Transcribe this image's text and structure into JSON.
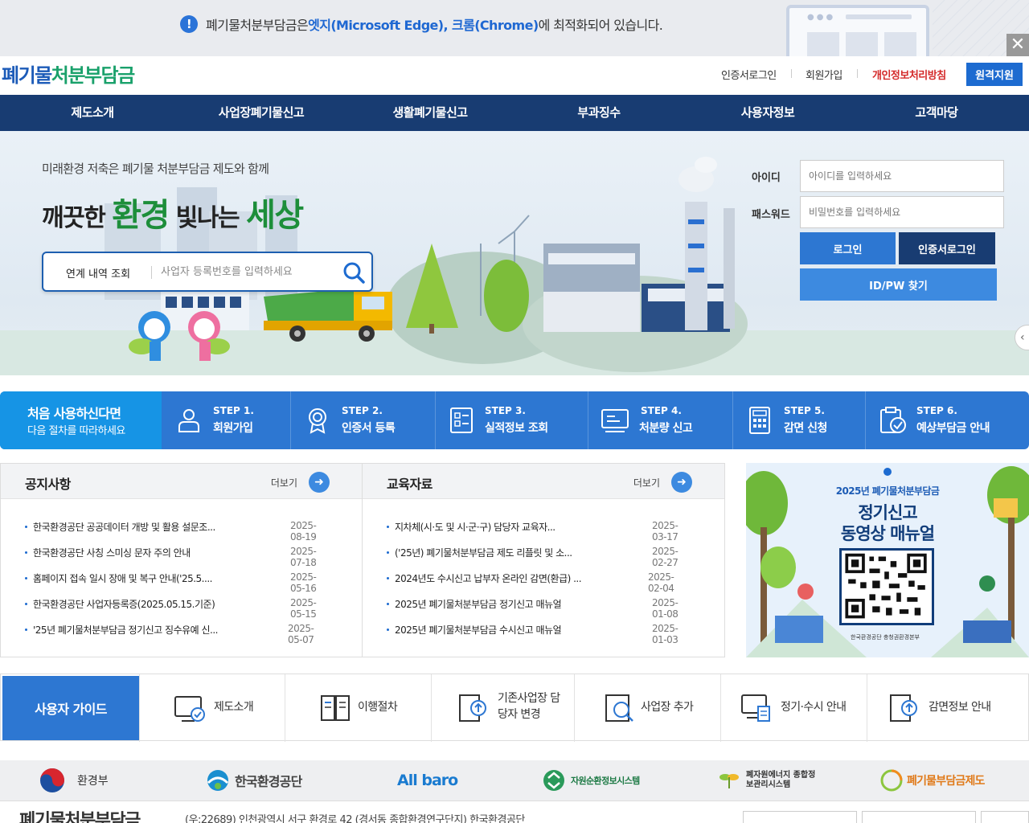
{
  "notice": {
    "text_before": "폐기물처분부담금은 ",
    "browsers": "엣지(Microsoft Edge), 크롬(Chrome)",
    "text_after": "에 최적화되어 있습니다.",
    "close_glyph": "✕"
  },
  "header": {
    "logo_part1": "폐기물",
    "logo_part2": "처분부담금",
    "links": [
      "인증서로그인",
      "회원가입",
      "개인정보처리방침"
    ],
    "remote_support": "원격지원"
  },
  "nav": [
    "제도소개",
    "사업장폐기물신고",
    "생활폐기물신고",
    "부과징수",
    "사용자정보",
    "고객마당"
  ],
  "hero": {
    "subtitle": "미래환경 저축은 폐기물 처분부담금 제도와 함께",
    "headline_1": "깨끗한 ",
    "headline_2": "환경",
    "headline_3": " 빛나는 ",
    "headline_4": "세상",
    "search_category": "연계 내역 조회",
    "search_placeholder": "사업자 등록번호를 입력하세요"
  },
  "login": {
    "id_label": "아이디",
    "id_placeholder": "아이디를 입력하세요",
    "pw_label": "패스워드",
    "pw_placeholder": "비밀번호를 입력하세요",
    "login_button": "로그인",
    "cert_login_button": "인증서로그인",
    "find_button": "ID/PW 찾기"
  },
  "steps": {
    "intro_title": "처음 사용하신다면",
    "intro_sub": "다음 절차를 따라하세요",
    "items": [
      {
        "num": "STEP 1.",
        "name": "회원가입",
        "icon": "person-icon"
      },
      {
        "num": "STEP 2.",
        "name": "인증서 등록",
        "icon": "certificate-icon"
      },
      {
        "num": "STEP 3.",
        "name": "실적정보 조회",
        "icon": "document-list-icon"
      },
      {
        "num": "STEP 4.",
        "name": "처분량 신고",
        "icon": "monitor-icon"
      },
      {
        "num": "STEP 5.",
        "name": "감면 신청",
        "icon": "calculator-icon"
      },
      {
        "num": "STEP 6.",
        "name": "예상부담금 안내",
        "icon": "clipboard-check-icon"
      }
    ]
  },
  "notices": {
    "title": "공지사항",
    "more": "더보기",
    "rows": [
      {
        "text": "한국환경공단 공공데이터 개방 및 활용 설문조...",
        "date": "2025-08-19"
      },
      {
        "text": "한국환경공단 사칭 스미싱 문자 주의 안내",
        "date": "2025-07-18"
      },
      {
        "text": "홈페이지 접속 일시 장애 및 복구 안내('25.5....",
        "date": "2025-05-16"
      },
      {
        "text": "한국환경공단 사업자등록증(2025.05.15.기준)",
        "date": "2025-05-15"
      },
      {
        "text": "'25년 폐기물처분부담금 정기신고 징수유예 신...",
        "date": "2025-05-07"
      }
    ]
  },
  "education": {
    "title": "교육자료",
    "more": "더보기",
    "rows": [
      {
        "text": "지차체(시·도 및 시·군·구) 담당자 교육자...",
        "date": "2025-03-17"
      },
      {
        "text": "('25년) 폐기물처분부담금 제도 리플릿 및 소...",
        "date": "2025-02-27"
      },
      {
        "text": "2024년도 수시신고 납부자 온라인 감면(환급) ...",
        "date": "2025-02-04"
      },
      {
        "text": "2025년 폐기물처분부담금 정기신고 매뉴얼",
        "date": "2025-01-08"
      },
      {
        "text": "2025년 폐기물처분부담금 수시신고 매뉴얼",
        "date": "2025-01-03"
      }
    ]
  },
  "promo": {
    "year_line": "2025년 폐기물처분부담금",
    "line1": "정기신고",
    "line2": "동영상 매뉴얼",
    "org": "한국환경공단 충청권환경본부"
  },
  "guide": {
    "title": "사용자 가이드",
    "items": [
      {
        "label": "제도소개",
        "icon": "monitor-check-icon"
      },
      {
        "label": "이행절차",
        "icon": "book-icon"
      },
      {
        "label": "기존사업장 담당자 변경",
        "icon": "document-upload-icon"
      },
      {
        "label": "사업장 추가",
        "icon": "search-window-icon"
      },
      {
        "label": "정기·수시 안내",
        "icon": "monitor-doc-icon"
      },
      {
        "label": "감면정보 안내",
        "icon": "document-upload-icon"
      }
    ]
  },
  "partners": [
    "환경부",
    "한국환경공단",
    "All baro",
    "자원순환정보시스템",
    "폐자원에너지 종합정보관리시스템",
    "폐기물부담금제도"
  ],
  "footer": {
    "logo": "폐기물처분부담금",
    "address": "(우:22689) 인천광역시 서구 환경로 42 (경서동 종합환경연구단지) 한국환경공단"
  },
  "colors": {
    "primary": "#183c72",
    "accent": "#2d77d2",
    "green": "#1d8e3a"
  }
}
